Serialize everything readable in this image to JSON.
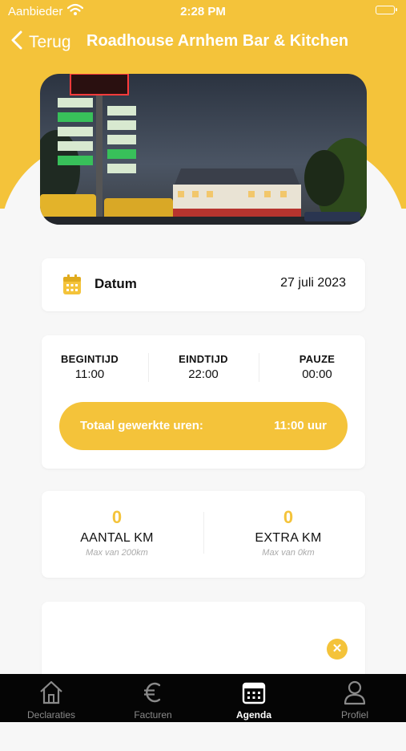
{
  "status_bar": {
    "carrier": "Aanbieder",
    "time": "2:28 PM"
  },
  "nav": {
    "back_label": "Terug",
    "title": "Roadhouse Arnhem Bar & Kitchen"
  },
  "date": {
    "label": "Datum",
    "value": "27 juli 2023"
  },
  "times": [
    {
      "label": "BEGINTIJD",
      "value": "11:00"
    },
    {
      "label": "EINDTIJD",
      "value": "22:00"
    },
    {
      "label": "PAUZE",
      "value": "00:00"
    }
  ],
  "total": {
    "label": "Totaal gewerkte uren:",
    "value": "11:00 uur"
  },
  "km": [
    {
      "value": "0",
      "label": "AANTAL KM",
      "sub": "Max van 200km"
    },
    {
      "value": "0",
      "label": "EXTRA KM",
      "sub": "Max van 0km"
    }
  ],
  "tabs": [
    {
      "label": "Declaraties",
      "icon": "home-icon"
    },
    {
      "label": "Facturen",
      "icon": "euro-icon"
    },
    {
      "label": "Agenda",
      "icon": "calendar-icon",
      "active": true
    },
    {
      "label": "Profiel",
      "icon": "person-icon"
    }
  ],
  "colors": {
    "accent": "#f4c33a",
    "background": "#f7f7f7",
    "tabbar": "#050505"
  }
}
